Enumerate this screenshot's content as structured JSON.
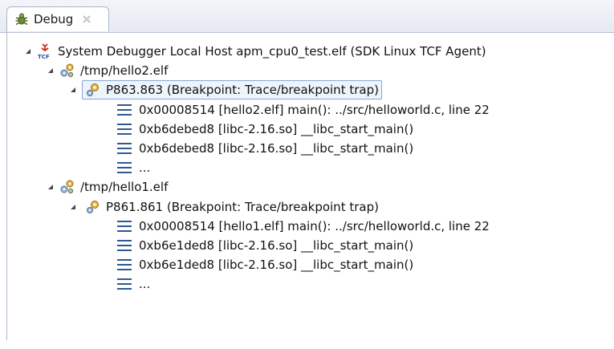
{
  "tab": {
    "title": "Debug",
    "icon": "debug-bug-icon",
    "close_icon": "close-icon"
  },
  "tree": {
    "launch": {
      "label": "System Debugger Local Host apm_cpu0_test.elf (SDK Linux TCF Agent)",
      "icon": "tcf-launch-icon"
    },
    "processes": [
      {
        "label": "/tmp/hello2.elf",
        "icon": "process-gears-icon",
        "thread": {
          "label": "P863.863 (Breakpoint: Trace/breakpoint trap)",
          "icon": "thread-suspended-icon",
          "selected": true,
          "frames": [
            "0x00008514 [hello2.elf] main(): ../src/helloworld.c, line 22",
            "0xb6debed8 [libc-2.16.so] __libc_start_main()",
            "0xb6debed8 [libc-2.16.so] __libc_start_main()",
            "..."
          ]
        }
      },
      {
        "label": "/tmp/hello1.elf",
        "icon": "process-gears-icon",
        "thread": {
          "label": "P861.861 (Breakpoint: Trace/breakpoint trap)",
          "icon": "thread-suspended-icon",
          "selected": false,
          "frames": [
            "0x00008514 [hello1.elf] main(): ../src/helloworld.c, line 22",
            "0xb6e1ded8 [libc-2.16.so] __libc_start_main()",
            "0xb6e1ded8 [libc-2.16.so] __libc_start_main()",
            "..."
          ]
        }
      }
    ]
  },
  "colors": {
    "frame_icon": "#2e5a8f",
    "selection_border": "#86a8d6",
    "tab_border": "#a9b6c9"
  }
}
